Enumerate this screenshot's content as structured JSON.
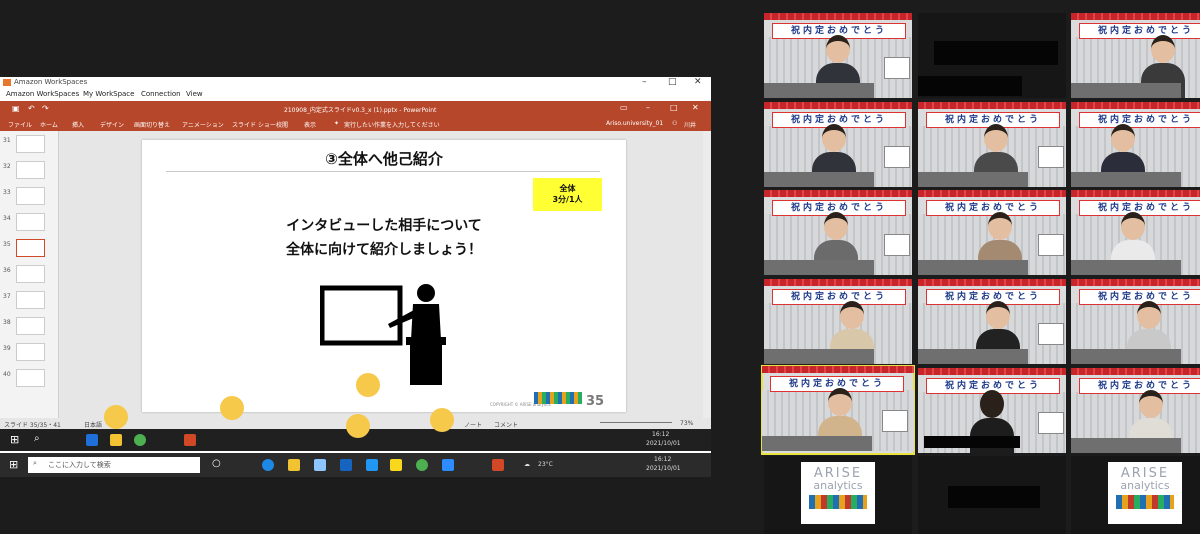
{
  "workspaces": {
    "title": "Amazon WorkSpaces",
    "menu": [
      "Amazon WorkSpaces",
      "My WorkSpace",
      "Connection",
      "View"
    ]
  },
  "powerpoint": {
    "filename": "210908_内定式スライドv0.3_x (1).pptx - PowerPoint",
    "account": "Ariso.university_01",
    "user_initials": "川井",
    "tabs": [
      "ファイル",
      "ホーム",
      "挿入",
      "デザイン",
      "画面切り替え",
      "アニメーション",
      "スライド ショー",
      "校閲",
      "表示"
    ],
    "tell_me": "実行したい作業を入力してください",
    "thumb_numbers": [
      "31",
      "32",
      "33",
      "34",
      "35",
      "36",
      "37",
      "38",
      "39",
      "40"
    ],
    "selected_thumb": "35",
    "status_left": "スライド 35/35・41",
    "status_lang": "日本語",
    "status_notes": "ノート",
    "status_comments": "コメント",
    "zoom": "73%"
  },
  "slide": {
    "title": "③全体へ他己紹介",
    "badge_line1": "全体",
    "badge_line2": "3分/1人",
    "body_line1": "インタビューした相手について",
    "body_line2": "全体に向けて紹介しましょう！",
    "number": "35",
    "copyright": "COPYRIGHT © ARISE analytics"
  },
  "taskbar": {
    "search_placeholder": "ここに入力して検索",
    "weather": "23°C",
    "time1": "16:12",
    "date1": "2021/10/01",
    "time2": "16:12",
    "date2": "2021/10/01"
  },
  "gallery": {
    "banner_text": "祝内定おめでとう",
    "logo_line1": "ARISE",
    "logo_line2": "analytics"
  },
  "colors": {
    "ppt_red": "#b7472a",
    "active_speaker": "#e8e340",
    "slide_badge": "#ffff33"
  }
}
